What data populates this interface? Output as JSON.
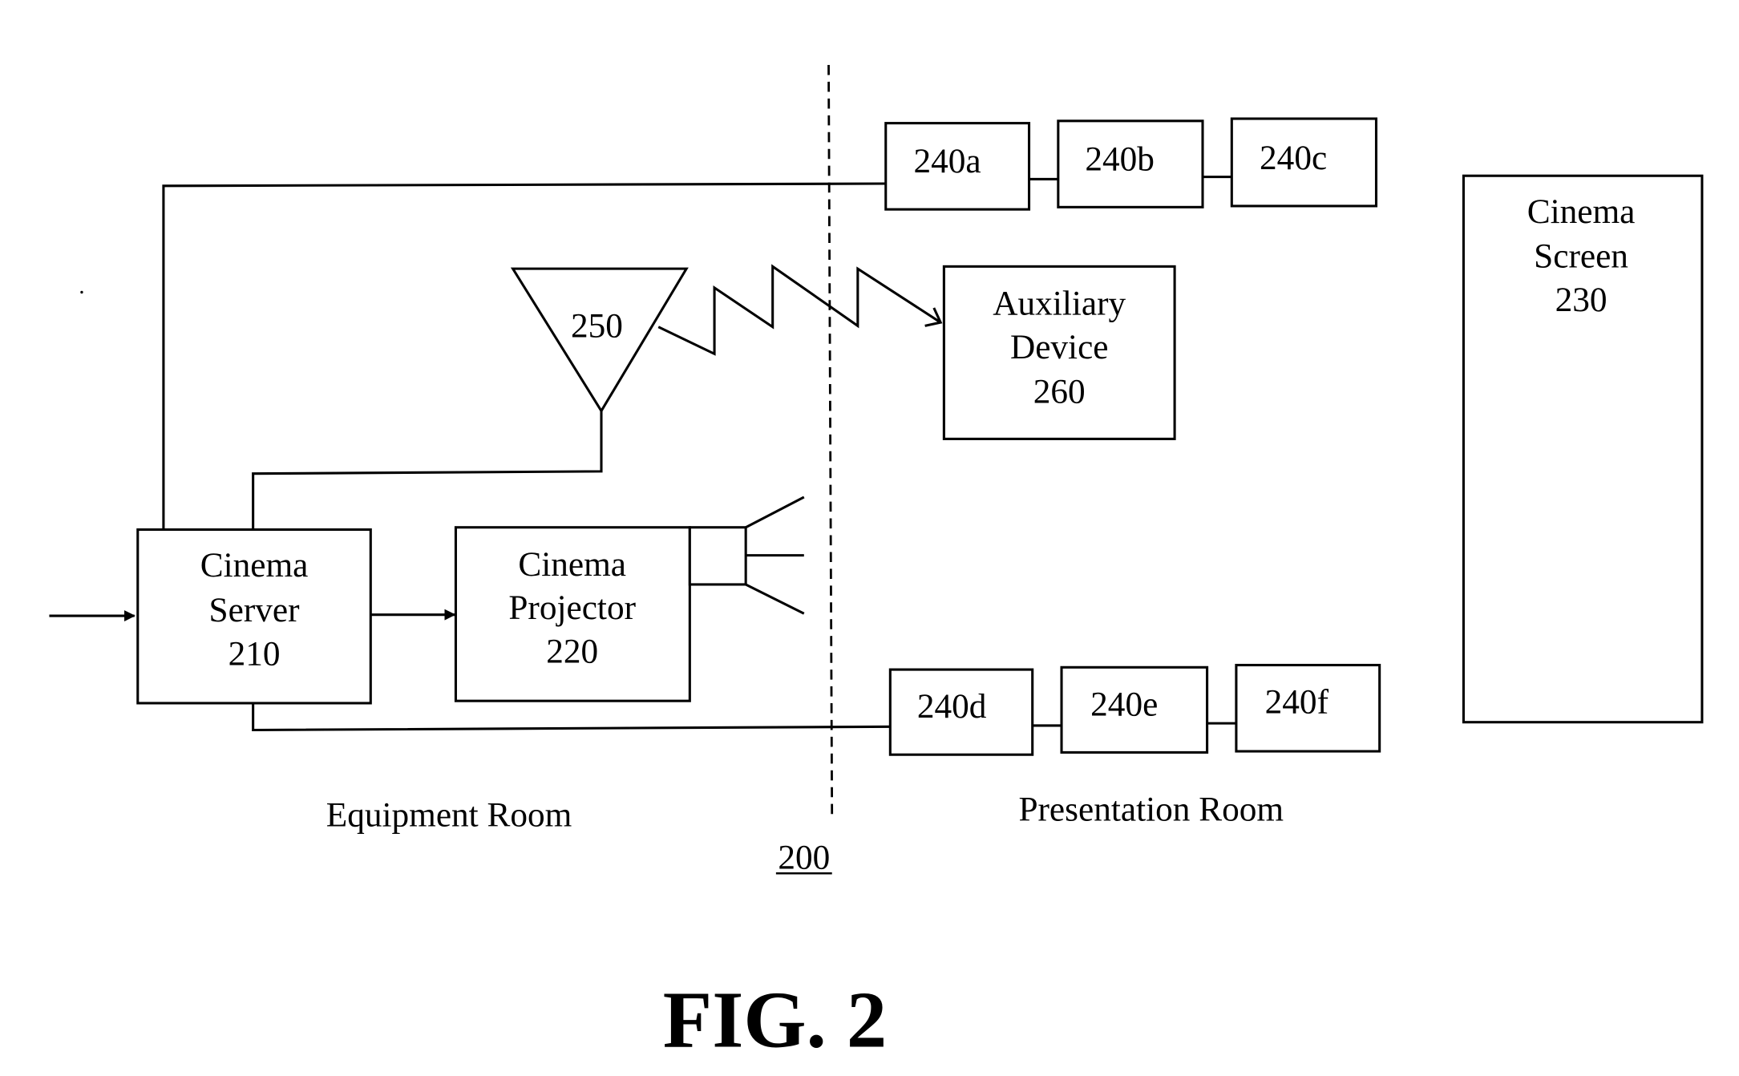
{
  "figure": {
    "title": "FIG. 2",
    "reference": "200"
  },
  "regions": {
    "equipment_room": "Equipment Room",
    "presentation_room": "Presentation Room"
  },
  "nodes": {
    "cinema_server": {
      "line1": "Cinema",
      "line2": "Server",
      "line3": "210"
    },
    "cinema_projector": {
      "line1": "Cinema",
      "line2": "Projector",
      "line3": "220"
    },
    "cinema_screen": {
      "line1": "Cinema",
      "line2": "Screen",
      "line3": "230"
    },
    "antenna": {
      "label": "250"
    },
    "auxiliary_device": {
      "line1": "Auxiliary",
      "line2": "Device",
      "line3": "260"
    },
    "speakers_top": [
      "240a",
      "240b",
      "240c"
    ],
    "speakers_bottom": [
      "240d",
      "240e",
      "240f"
    ]
  },
  "edges": [
    {
      "from": "input",
      "to": "cinema_server",
      "type": "arrow"
    },
    {
      "from": "cinema_server",
      "to": "cinema_projector",
      "type": "arrow"
    },
    {
      "from": "cinema_server",
      "to": "antenna",
      "type": "line"
    },
    {
      "from": "antenna",
      "to": "auxiliary_device",
      "type": "wireless-arrow"
    },
    {
      "from": "cinema_server",
      "to": "240a",
      "type": "line"
    },
    {
      "from": "240a",
      "to": "240b",
      "type": "line"
    },
    {
      "from": "240b",
      "to": "240c",
      "type": "line"
    },
    {
      "from": "cinema_server",
      "to": "240d",
      "type": "line"
    },
    {
      "from": "240d",
      "to": "240e",
      "type": "line"
    },
    {
      "from": "240e",
      "to": "240f",
      "type": "line"
    }
  ]
}
